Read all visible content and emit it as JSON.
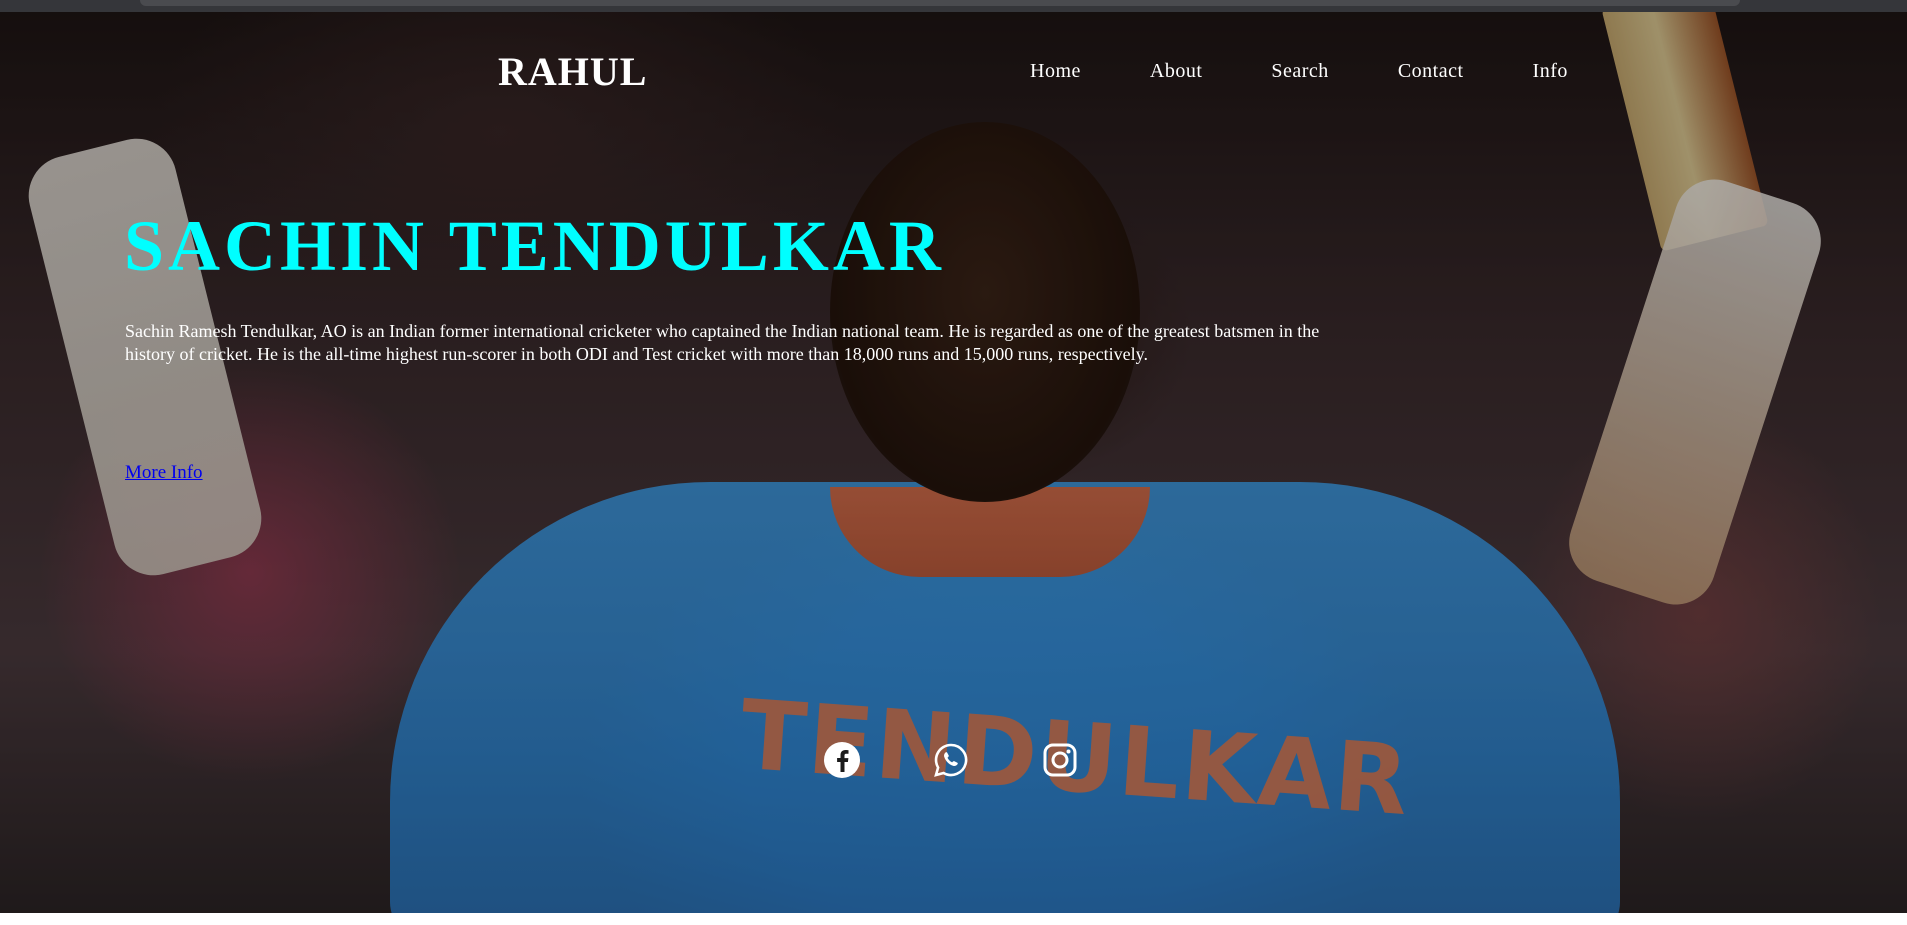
{
  "header": {
    "logo": "RAHUL",
    "nav": [
      "Home",
      "About",
      "Search",
      "Contact",
      "Info"
    ]
  },
  "hero": {
    "title": "SACHIN TENDULKAR",
    "description": "Sachin Ramesh Tendulkar, AO is an Indian former international cricketer who captained the Indian national team. He is regarded as one of the greatest batsmen in the history of cricket. He is the all-time highest run-scorer in both ODI and Test cricket with more than 18,000 runs and 15,000 runs, respectively.",
    "link_label": "More Info",
    "jersey_name": "TENDULKAR"
  },
  "social": {
    "icons": [
      "facebook-icon",
      "whatsapp-icon",
      "instagram-icon"
    ]
  },
  "colors": {
    "title": "#00ffff",
    "text": "#ffffff",
    "link": "#0000ee"
  }
}
